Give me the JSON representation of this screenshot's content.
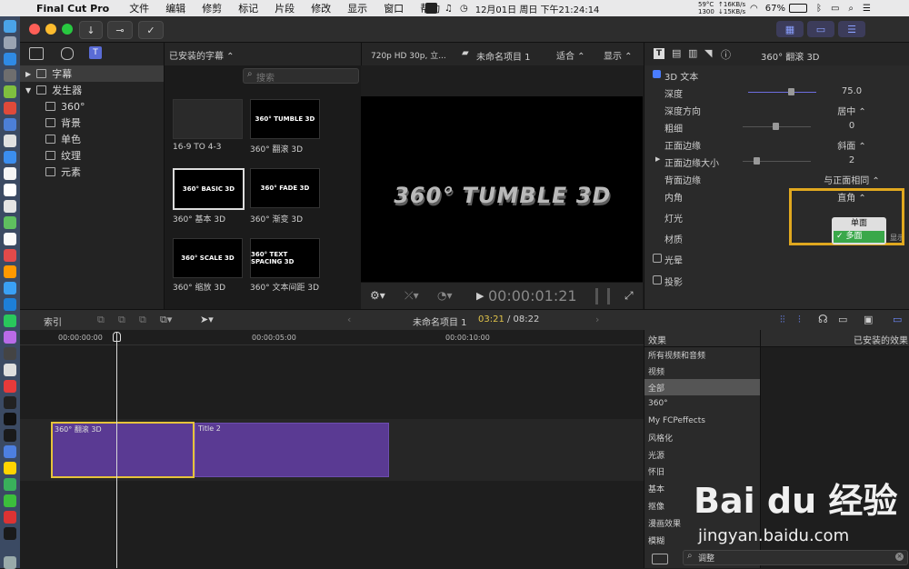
{
  "menubar": {
    "app_name": "Final Cut Pro",
    "items": [
      "文件",
      "编辑",
      "修剪",
      "标记",
      "片段",
      "修改",
      "显示",
      "窗口",
      "帮助"
    ],
    "cpu_temp": "59°C",
    "cpu_rpm": "1300",
    "net_up": "↑16KB/s",
    "net_down": "↓15KB/s",
    "battery": "67%",
    "clock": "12月01日 周日 下午21:24:14"
  },
  "library": {
    "title": "已安装的字幕 ⌃",
    "search_placeholder": "搜索",
    "tree": [
      {
        "label": "字幕",
        "level": 0,
        "selected": true
      },
      {
        "label": "发生器",
        "level": 0,
        "selected": false
      },
      {
        "label": "360°",
        "level": 1
      },
      {
        "label": "背景",
        "level": 1
      },
      {
        "label": "单色",
        "level": 1
      },
      {
        "label": "纹理",
        "level": 1
      },
      {
        "label": "元素",
        "level": 1
      }
    ],
    "thumbs": [
      {
        "text": "",
        "label": "16-9 TO 4-3"
      },
      {
        "text": "360° TUMBLE 3D",
        "label": "360° 翻滚 3D"
      },
      {
        "text": "360° BASIC 3D",
        "label": "360° 基本 3D"
      },
      {
        "text": "360° FADE 3D",
        "label": "360° 渐变 3D"
      },
      {
        "text": "360° SCALE 3D",
        "label": "360° 缩放 3D"
      },
      {
        "text": "360° TEXT SPACING 3D",
        "label": "360° 文本间距 3D"
      }
    ]
  },
  "viewer": {
    "format": "720p HD 30p, 立...",
    "project": "未命名项目 1",
    "fit": "适合 ⌃",
    "display": "显示 ⌃",
    "overlay_text": "360° TUMBLE 3D",
    "timecode": "00:00:01:21"
  },
  "inspector": {
    "title": "360° 翻滚 3D",
    "section": "3D 文本",
    "rows": [
      {
        "label": "深度",
        "value": "75.0",
        "slider": 0.62
      },
      {
        "label": "深度方向",
        "value": "居中 ⌃"
      },
      {
        "label": "粗细",
        "value": "0",
        "slider": 0.5
      },
      {
        "label": "正面边缘",
        "value": "斜面 ⌃"
      },
      {
        "label": "正面边缘大小",
        "value": "2",
        "slider": 0.2
      },
      {
        "label": "背面边缘",
        "value": "与正面相同 ⌃"
      },
      {
        "label": "内角",
        "value": "直角 ⌃"
      },
      {
        "label": "灯光",
        "value": ""
      },
      {
        "label": "材质",
        "value": "显示"
      }
    ],
    "checks": [
      {
        "label": "光晕"
      },
      {
        "label": "投影"
      }
    ],
    "popup_options": [
      "单面",
      "多面"
    ],
    "popup_selected": "多面"
  },
  "timeline": {
    "index_label": "索引",
    "project": "未命名项目 1",
    "position": "03:21",
    "duration": "/ 08:22",
    "ruler": [
      "00:00:00:00",
      "00:00:05:00",
      "00:00:10:00"
    ],
    "clips": [
      {
        "label": "360° 翻滚 3D"
      },
      {
        "label": "Title 2"
      }
    ]
  },
  "effects": {
    "header": "效果",
    "installed_header": "已安装的效果",
    "items": [
      "所有视频和音频",
      "视频",
      "全部",
      "360°",
      "My FCPeffects",
      "风格化",
      "光源",
      "怀旧",
      "基本",
      "抠像",
      "漫画效果",
      "模糊"
    ],
    "search_value": "调整"
  },
  "watermark": {
    "brand": "Bai du 经验",
    "url": "jingyan.baidu.com"
  }
}
